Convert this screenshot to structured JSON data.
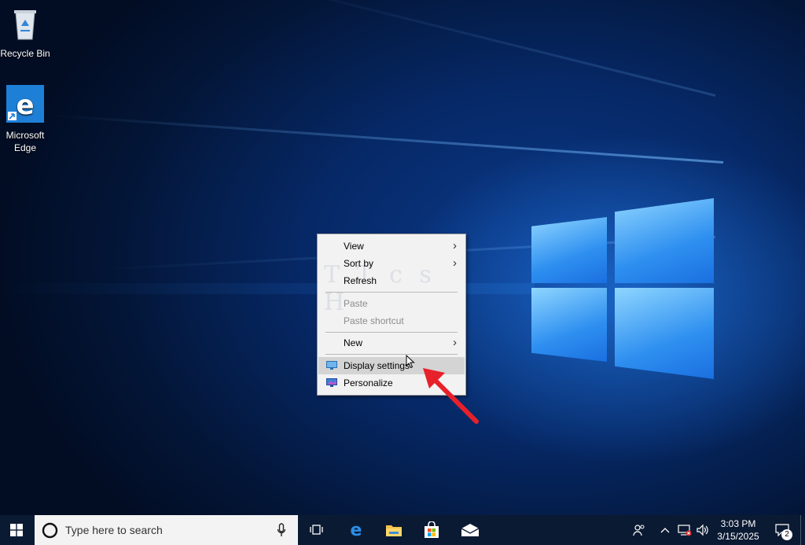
{
  "desktop": {
    "icons": [
      {
        "label": "Recycle Bin",
        "icon": "recycle-bin-icon"
      },
      {
        "label": "Microsoft Edge",
        "icon": "edge-icon"
      }
    ],
    "watermark": "T T c s H"
  },
  "context_menu": {
    "items": [
      {
        "label": "View",
        "submenu": true,
        "enabled": true
      },
      {
        "label": "Sort by",
        "submenu": true,
        "enabled": true
      },
      {
        "label": "Refresh",
        "submenu": false,
        "enabled": true
      },
      {
        "label": "Paste",
        "submenu": false,
        "enabled": false
      },
      {
        "label": "Paste shortcut",
        "submenu": false,
        "enabled": false
      },
      {
        "label": "New",
        "submenu": true,
        "enabled": true
      },
      {
        "label": "Display settings",
        "submenu": false,
        "enabled": true,
        "highlighted": true,
        "icon": "display-icon"
      },
      {
        "label": "Personalize",
        "submenu": false,
        "enabled": true,
        "icon": "personalize-icon"
      }
    ],
    "submenu_glyph": "›"
  },
  "taskbar": {
    "search_placeholder": "Type here to search",
    "pinned": [
      "task-view-icon",
      "edge-icon",
      "file-explorer-icon",
      "store-icon",
      "mail-icon"
    ],
    "tray": {
      "time": "3:03 PM",
      "date": "3/15/2025",
      "notification_count": "2"
    }
  },
  "colors": {
    "accent": "#1a8cff",
    "taskbar": "#0b1a33",
    "menu_bg": "#f2f2f2",
    "arrow": "#e8202a"
  }
}
